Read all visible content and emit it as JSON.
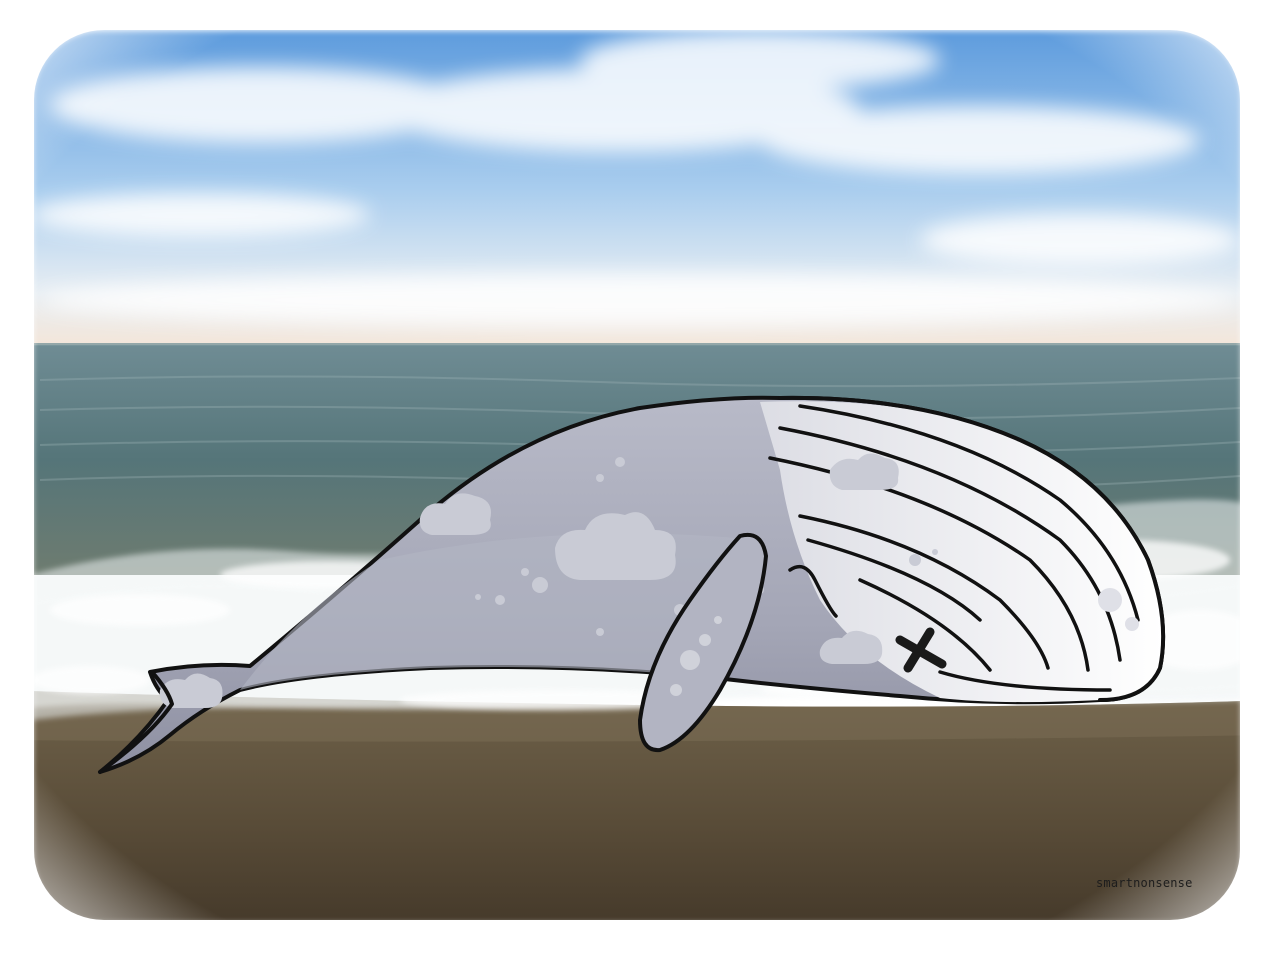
{
  "illustration": {
    "subject": "whale-on-beach",
    "signature": "smartnonsense",
    "colors": {
      "sky_top": "#5e9fdf",
      "sky_horizon": "#f1e6dc",
      "sea": "#5f7e84",
      "surf": "#eef3f4",
      "sand": "#5b4e3a",
      "whale_body": "#a7a9b9",
      "whale_belly": "#ffffff",
      "outline": "#111111",
      "frame": "#ffffff"
    }
  }
}
